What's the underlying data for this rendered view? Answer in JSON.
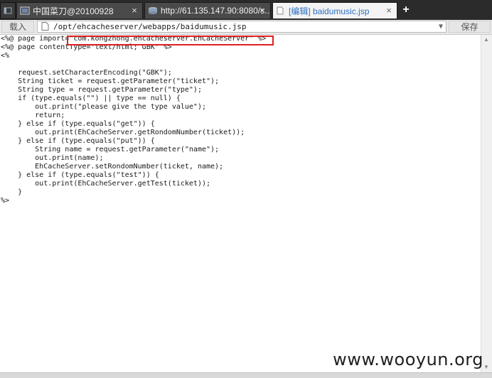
{
  "tabs": [
    {
      "label": "中国菜刀@20100928",
      "active": false
    },
    {
      "label": "http://61.135.147.90:8080/s...",
      "active": false
    },
    {
      "label": "[编辑] baidumusic.jsp",
      "active": true
    }
  ],
  "new_tab_symbol": "+",
  "toolbar": {
    "load_label": "载入",
    "path_value": "/opt/ehcacheserver/webapps/baidumusic.jsp",
    "save_label": "保存"
  },
  "editor": {
    "code": "<%@ page import=\"com.kongzhong.ehcacheserver.EhCacheServer\" %>\n<%@ page contentType=\"text/html; GBK\" %>\n<%\n\n    request.setCharacterEncoding(\"GBK\");\n    String ticket = request.getParameter(\"ticket\");\n    String type = request.getParameter(\"type\");\n    if (type.equals(\"\") || type == null) {\n        out.print(\"please give the type value\");\n        return;\n    } else if (type.equals(\"get\")) {\n        out.print(EhCacheServer.getRondomNumber(ticket));\n    } else if (type.equals(\"put\")) {\n        String name = request.getParameter(\"name\");\n        out.print(name);\n        EhCacheServer.setRondomNumber(ticket, name);\n    } else if (type.equals(\"test\")) {\n        out.print(EhCacheServer.getTest(ticket));\n    }\n%>"
  },
  "watermark": "www.wooyun.org",
  "colors": {
    "highlight": "#e02020",
    "active_tab_text": "#2d6fc2",
    "tabbar_bg": "#2b2b2b"
  }
}
